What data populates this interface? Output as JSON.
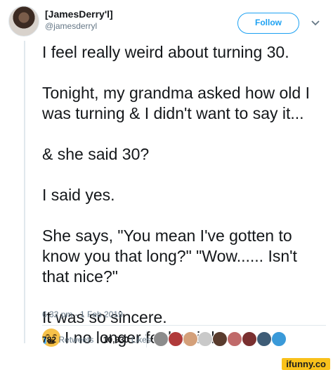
{
  "author": {
    "display_name": "[JamesDerry'l]",
    "handle": "@jamesderryl"
  },
  "actions": {
    "follow_label": "Follow",
    "menu_icon": "chevron-down-icon"
  },
  "tweet": {
    "paragraphs": [
      [
        "I feel really weird about turning 30."
      ],
      [
        "Tonight, my grandma asked how old I",
        "was turning & I didn't want to say it..."
      ],
      [
        "& she said 30?"
      ],
      [
        "I said yes."
      ],
      [
        "She says, \"You mean I've gotten to",
        "know you that long?\" \"Wow...... Isn't",
        "that nice?\""
      ],
      [
        "It was so sincere."
      ]
    ],
    "last_line_emoji": "loudly-crying-face-emoji",
    "last_line_text": "I no longer feel weird.",
    "timestamp": "6:32 pm - 1 Feb 2019"
  },
  "stats": {
    "retweets_count": "782",
    "retweets_label": "Retweets",
    "likes_count": "10,930",
    "likes_label": "Likes"
  },
  "likers": {
    "colors": [
      "#8c8c8c",
      "#b03a3a",
      "#d4a07a",
      "#c9c9c9",
      "#5a3c2e",
      "#c06a6a",
      "#7a3030",
      "#3e5c76",
      "#3a9ad9"
    ]
  },
  "watermark": {
    "text": "ifunny.co",
    "color": "#f9c11b"
  }
}
